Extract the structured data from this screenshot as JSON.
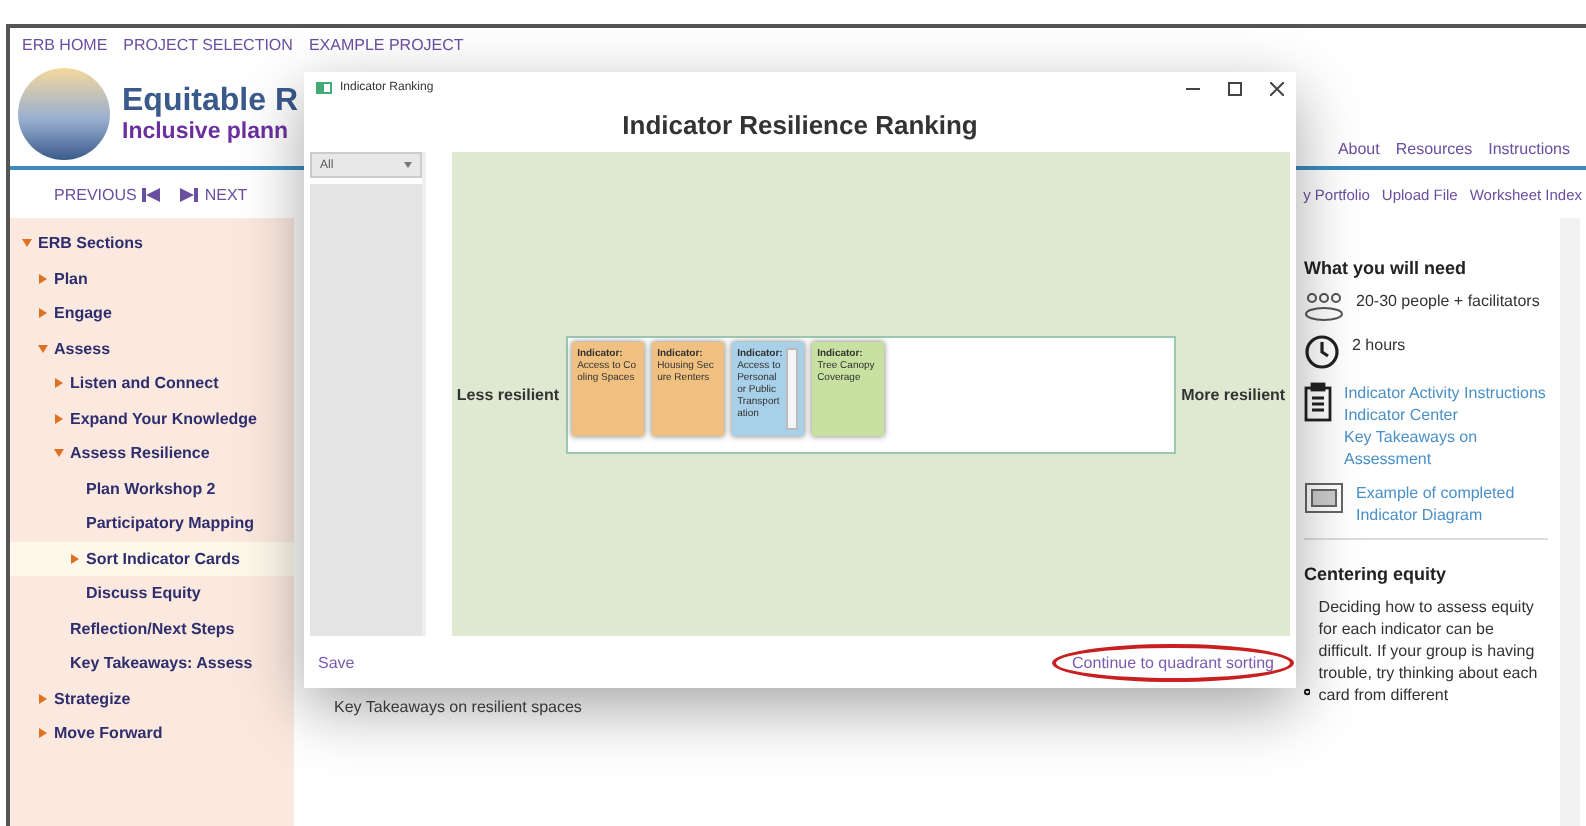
{
  "top_nav": [
    "ERB HOME",
    "PROJECT SELECTION",
    "EXAMPLE PROJECT"
  ],
  "header": {
    "title": "Equitable R",
    "subtitle": "Inclusive plann",
    "menu": [
      "About",
      "Resources",
      "Instructions"
    ]
  },
  "pager": {
    "previous": "PREVIOUS",
    "next": "NEXT"
  },
  "tools": [
    "y Portfolio",
    "Upload File",
    "Worksheet Index"
  ],
  "sidebar": {
    "items": [
      {
        "label": "ERB Sections",
        "expanded": true,
        "selected": false,
        "children": [
          {
            "label": "Plan",
            "expanded": false,
            "selected": false
          },
          {
            "label": "Engage",
            "expanded": false,
            "selected": false
          },
          {
            "label": "Assess",
            "expanded": true,
            "selected": false,
            "children": [
              {
                "label": "Listen and Connect",
                "expanded": false,
                "selected": false
              },
              {
                "label": "Expand Your Knowledge",
                "expanded": false,
                "selected": false
              },
              {
                "label": "Assess Resilience",
                "expanded": true,
                "selected": false,
                "children": [
                  {
                    "label": "Plan Workshop 2",
                    "selected": false
                  },
                  {
                    "label": "Participatory Mapping",
                    "selected": false
                  },
                  {
                    "label": "Sort Indicator Cards",
                    "expanded": false,
                    "selected": true
                  },
                  {
                    "label": "Discuss Equity",
                    "selected": false
                  }
                ]
              },
              {
                "label": "Reflection/Next Steps",
                "selected": false
              },
              {
                "label": "Key Takeaways: Assess",
                "selected": false
              }
            ]
          },
          {
            "label": "Strategize",
            "expanded": false,
            "selected": false
          },
          {
            "label": "Move Forward",
            "expanded": false,
            "selected": false
          }
        ]
      }
    ]
  },
  "behind_text": "Key Takeaways on resilient spaces",
  "right_panel": {
    "need_title": "What you will need",
    "needs": [
      {
        "kind": "people",
        "texts": [
          "20-30 people + facilitators"
        ]
      },
      {
        "kind": "clock",
        "texts": [
          "2 hours"
        ]
      },
      {
        "kind": "clipboard",
        "links": [
          "Indicator Activity Instructions",
          "Indicator Center",
          "Key Takeaways on Assessment"
        ]
      },
      {
        "kind": "image",
        "links": [
          "Example of completed Indicator Diagram"
        ]
      }
    ],
    "equity_title": "Centering equity",
    "equity_text": "Deciding how to assess equity for each indicator can be difficult. If your group is having trouble, try thinking about each card from different"
  },
  "dialog": {
    "window_title": "Indicator Ranking",
    "heading": "Indicator Resilience Ranking",
    "filter": "All",
    "less_label": "Less resilient",
    "more_label": "More resilient",
    "cards": [
      {
        "title": "Indicator:",
        "name": "Access to Cooling Spaces",
        "color": "#f0c080",
        "scrollable": false
      },
      {
        "title": "Indicator:",
        "name": "Housing Secure Renters",
        "color": "#f0c080",
        "scrollable": false
      },
      {
        "title": "Indicator:",
        "name": "Access to Personal or Public Transportation",
        "color": "#a8d0e8",
        "scrollable": true
      },
      {
        "title": "Indicator:",
        "name": "Tree Canopy Coverage",
        "color": "#c8e0a0",
        "scrollable": false
      }
    ],
    "save": "Save",
    "continue": "Continue to quadrant sorting"
  }
}
